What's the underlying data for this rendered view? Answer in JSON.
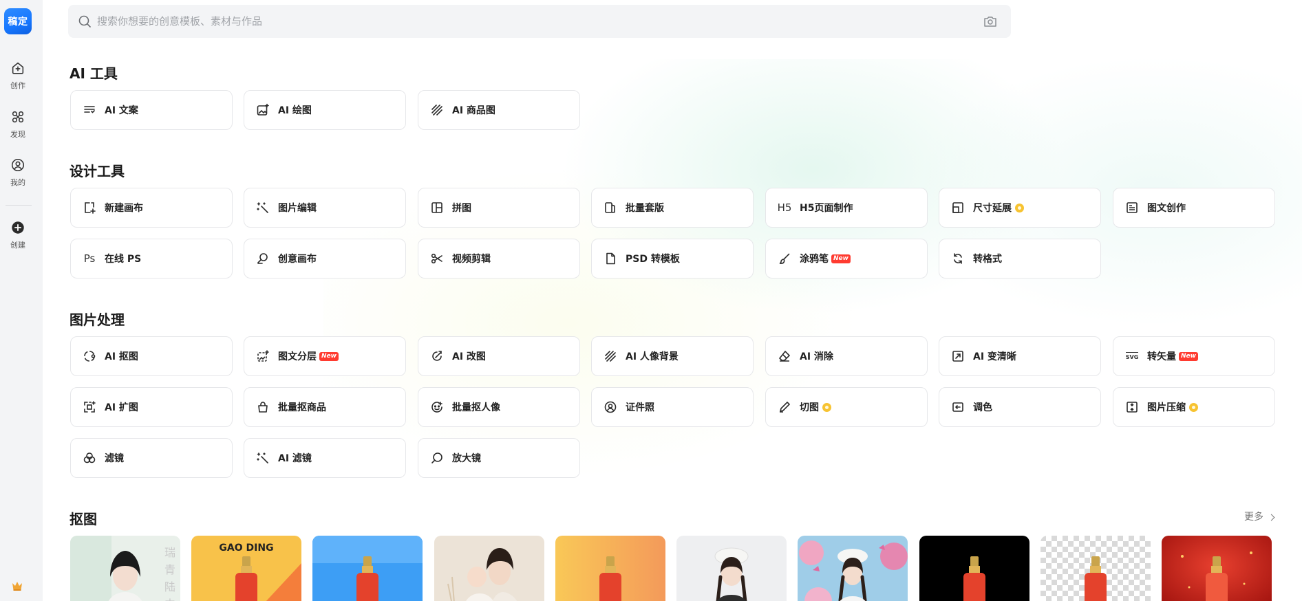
{
  "sidebar": {
    "logo": "稿定",
    "items": [
      {
        "label": "创作",
        "icon": "home-plus-icon"
      },
      {
        "label": "发现",
        "icon": "discover-icon"
      },
      {
        "label": "我的",
        "icon": "profile-icon"
      },
      {
        "label": "创建",
        "icon": "add-circle-icon"
      }
    ]
  },
  "search": {
    "placeholder": "搜索你想要的创意模板、素材与作品"
  },
  "sections": {
    "ai_tools": {
      "title": "AI 工具",
      "items": [
        {
          "label": "AI 文案",
          "icon": "text-lines-icon"
        },
        {
          "label": "AI 绘图",
          "icon": "image-sparkle-icon"
        },
        {
          "label": "AI 商品图",
          "icon": "diagonal-lines-icon"
        }
      ]
    },
    "design_tools": {
      "title": "设计工具",
      "items": [
        {
          "label": "新建画布",
          "icon": "new-canvas-icon"
        },
        {
          "label": "图片编辑",
          "icon": "magic-wand-icon"
        },
        {
          "label": "拼图",
          "icon": "collage-grid-icon"
        },
        {
          "label": "批量套版",
          "icon": "batch-template-icon"
        },
        {
          "label": "H5页面制作",
          "icon": "h5-icon",
          "icon_text": "H5"
        },
        {
          "label": "尺寸延展",
          "icon": "resize-icon",
          "badge": "vip"
        },
        {
          "label": "图文创作",
          "icon": "article-icon"
        },
        {
          "label": "在线 PS",
          "icon": "ps-icon",
          "icon_text": "Ps"
        },
        {
          "label": "创意画布",
          "icon": "creative-canvas-icon"
        },
        {
          "label": "视频剪辑",
          "icon": "scissors-icon"
        },
        {
          "label": "PSD 转模板",
          "icon": "file-icon"
        },
        {
          "label": "涂鸦笔",
          "icon": "brush-icon",
          "badge": "New"
        },
        {
          "label": "转格式",
          "icon": "convert-icon"
        }
      ]
    },
    "image_processing": {
      "title": "图片处理",
      "items": [
        {
          "label": "AI 抠图",
          "icon": "cutout-icon"
        },
        {
          "label": "图文分层",
          "icon": "layers-icon",
          "badge": "New"
        },
        {
          "label": "AI 改图",
          "icon": "edit-image-icon"
        },
        {
          "label": "AI 人像背景",
          "icon": "portrait-bg-icon"
        },
        {
          "label": "AI 消除",
          "icon": "eraser-icon"
        },
        {
          "label": "AI 变清晰",
          "icon": "enhance-icon"
        },
        {
          "label": "转矢量",
          "icon": "svg-icon",
          "badge": "New",
          "icon_text": "SVG"
        },
        {
          "label": "AI 扩图",
          "icon": "expand-icon"
        },
        {
          "label": "批量抠商品",
          "icon": "shopping-bag-icon"
        },
        {
          "label": "批量抠人像",
          "icon": "face-icon"
        },
        {
          "label": "证件照",
          "icon": "id-photo-icon"
        },
        {
          "label": "切图",
          "icon": "pen-icon",
          "badge": "vip"
        },
        {
          "label": "调色",
          "icon": "color-adjust-icon"
        },
        {
          "label": "图片压缩",
          "icon": "compress-icon",
          "badge": "vip"
        },
        {
          "label": "滤镜",
          "icon": "filter-icon"
        },
        {
          "label": "AI 滤镜",
          "icon": "magic-wand-icon"
        },
        {
          "label": "放大镜",
          "icon": "magnifier-icon"
        }
      ]
    },
    "cutout": {
      "title": "抠图",
      "more": "更多",
      "thumbnails": [
        {
          "name": "woman-portrait-thumb",
          "caption": "瑞青陆中"
        },
        {
          "name": "serum-yellow-thumb",
          "caption": "GAO DING"
        },
        {
          "name": "serum-blue-thumb"
        },
        {
          "name": "mother-baby-thumb"
        },
        {
          "name": "serum-orange-thumb"
        },
        {
          "name": "girl-hat-gray-thumb"
        },
        {
          "name": "girl-butterfly-thumb"
        },
        {
          "name": "serum-black-thumb"
        },
        {
          "name": "serum-transparent-thumb"
        },
        {
          "name": "serum-red-thumb"
        }
      ]
    }
  },
  "colors": {
    "brand_blue": "#1677ff",
    "new_badge": "#ff3b30",
    "vip_badge": "#f7c331"
  }
}
